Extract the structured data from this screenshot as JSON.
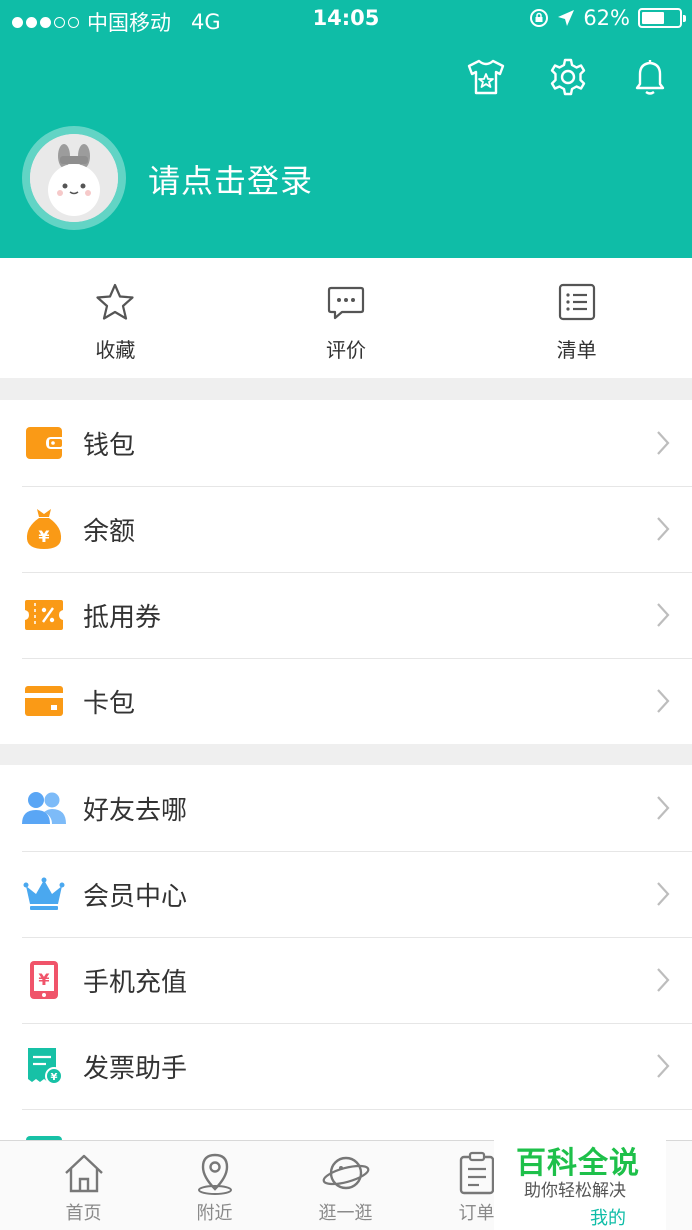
{
  "status_bar": {
    "carrier": "中国移动",
    "network": "4G",
    "time": "14:05",
    "battery": "62%",
    "battery_level": 0.62
  },
  "header": {
    "bg_color": "#0fbda7",
    "icons": [
      "shirt-star-icon",
      "settings-icon",
      "bell-icon"
    ],
    "login_text": "请点击登录"
  },
  "quick_actions": [
    {
      "label": "收藏",
      "icon": "star-icon"
    },
    {
      "label": "评价",
      "icon": "chat-bubble-icon"
    },
    {
      "label": "清单",
      "icon": "list-icon"
    }
  ],
  "menu_group_1": [
    {
      "label": "钱包",
      "icon": "wallet-icon",
      "color": "#fa9a16"
    },
    {
      "label": "余额",
      "icon": "money-bag-icon",
      "color": "#fa9a16"
    },
    {
      "label": "抵用券",
      "icon": "coupon-icon",
      "color": "#fa9a16"
    },
    {
      "label": "卡包",
      "icon": "card-icon",
      "color": "#fa9a16"
    }
  ],
  "menu_group_2": [
    {
      "label": "好友去哪",
      "icon": "friends-icon",
      "color": "#5aa6f5"
    },
    {
      "label": "会员中心",
      "icon": "crown-icon",
      "color": "#4aa8ef"
    },
    {
      "label": "手机充值",
      "icon": "phone-recharge-icon",
      "color": "#f0546a"
    },
    {
      "label": "发票助手",
      "icon": "invoice-icon",
      "color": "#17c1a6"
    }
  ],
  "tabbar": [
    {
      "label": "首页",
      "icon": "home-icon",
      "active": false
    },
    {
      "label": "附近",
      "icon": "location-icon",
      "active": false
    },
    {
      "label": "逛一逛",
      "icon": "planet-icon",
      "active": false
    },
    {
      "label": "订单",
      "icon": "order-icon",
      "active": false
    },
    {
      "label": "我的",
      "icon": "profile-icon",
      "active": true
    }
  ],
  "watermark": {
    "title": "百科全说",
    "subtitle": "助你轻松解决"
  }
}
